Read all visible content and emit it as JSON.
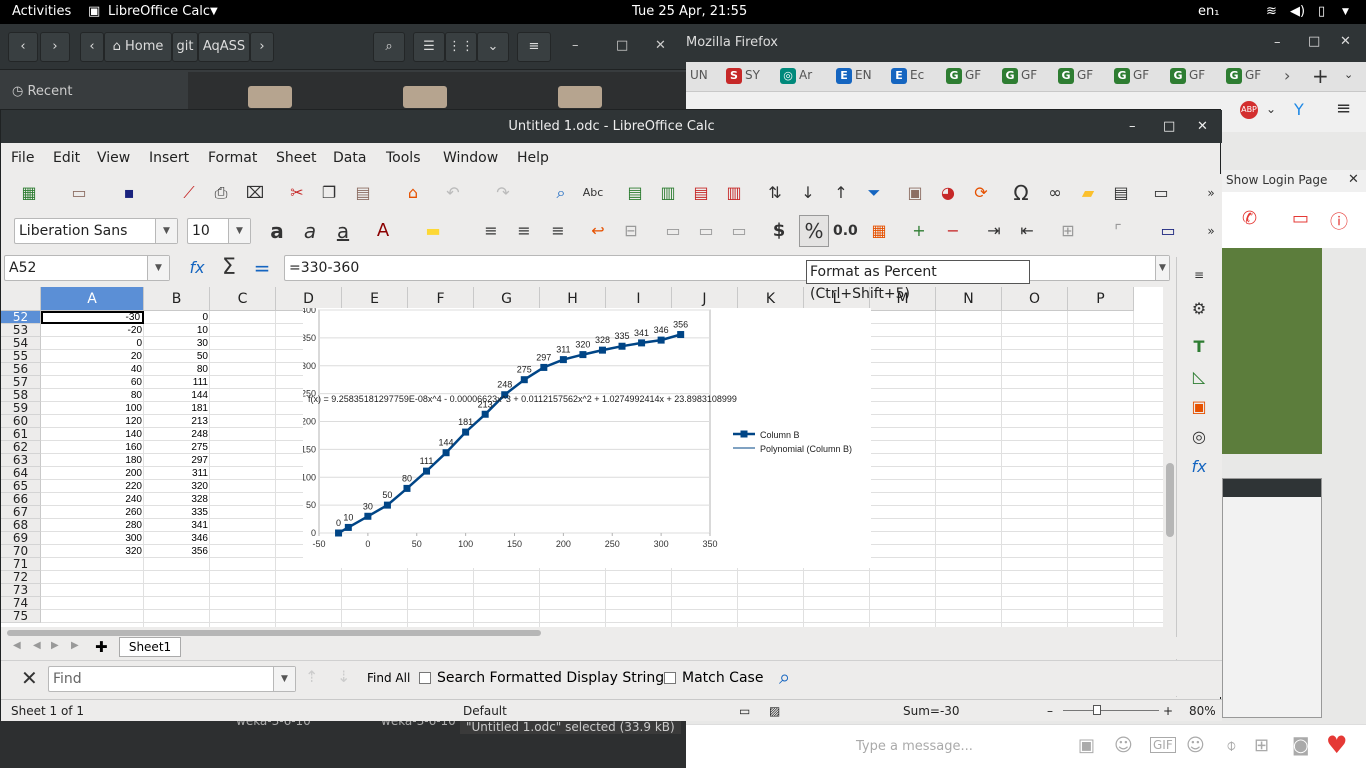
{
  "topbar": {
    "activities": "Activities",
    "app": "LibreOffice Calc",
    "clock": "Tue 25 Apr, 21:55",
    "lang": "en₁"
  },
  "files": {
    "home": "Home",
    "crumb2": "git",
    "crumb3": "AqASS",
    "recent": "Recent",
    "bottom1": "weka-3-6-10",
    "bottom2": "weka-3-6-10",
    "status": "\"Untitled 1.odc\" selected  (33.9 kB)"
  },
  "firefox": {
    "title": "Mozilla Firefox",
    "tabs": [
      "UN",
      "SY",
      "Ar",
      "EN",
      "Ec",
      "GF",
      "GF",
      "GF",
      "GF",
      "GF",
      "GF"
    ],
    "login": "Show Login Page",
    "message": "Type a message..."
  },
  "calc": {
    "title": "Untitled 1.odc - LibreOffice Calc",
    "menu": [
      "File",
      "Edit",
      "View",
      "Insert",
      "Format",
      "Sheet",
      "Data",
      "Tools",
      "Window",
      "Help"
    ],
    "font": "Liberation Sans",
    "size": "10",
    "namebox": "A52",
    "formula": "=330-360",
    "tooltip": "Format as Percent (Ctrl+Shift+5)",
    "pct": "%",
    "numfmt": "0.0",
    "dollar": "$",
    "columns": [
      "A",
      "B",
      "C",
      "D",
      "E",
      "F",
      "G",
      "H",
      "I",
      "J",
      "K",
      "L",
      "M",
      "N",
      "O",
      "P"
    ],
    "rows": [
      "52",
      "53",
      "54",
      "55",
      "56",
      "57",
      "58",
      "59",
      "60",
      "61",
      "62",
      "63",
      "64",
      "65",
      "66",
      "67",
      "68",
      "69",
      "70",
      "71",
      "72",
      "73",
      "74",
      "75"
    ],
    "colA": [
      "-30",
      "-20",
      "0",
      "20",
      "40",
      "60",
      "80",
      "100",
      "120",
      "140",
      "160",
      "180",
      "200",
      "220",
      "240",
      "260",
      "280",
      "300",
      "320"
    ],
    "colB": [
      "0",
      "10",
      "30",
      "50",
      "80",
      "111",
      "144",
      "181",
      "213",
      "248",
      "275",
      "297",
      "311",
      "320",
      "328",
      "335",
      "341",
      "346",
      "356"
    ],
    "sheet_tab": "Sheet1",
    "find_placeholder": "Find",
    "find_all": "Find All",
    "search_formatted": "Search Formatted Display String",
    "match_case": "Match Case",
    "status_sheet": "Sheet 1 of 1",
    "status_style": "Default",
    "status_sum": "Sum=-30",
    "zoom": "80%"
  },
  "chart_data": {
    "type": "scatter",
    "x": [
      -30,
      -20,
      0,
      20,
      40,
      60,
      80,
      100,
      120,
      140,
      160,
      180,
      200,
      220,
      240,
      260,
      280,
      300,
      320
    ],
    "series": [
      {
        "name": "Column B",
        "values": [
          0,
          10,
          30,
          50,
          80,
          111,
          144,
          181,
          213,
          248,
          275,
          297,
          311,
          320,
          328,
          335,
          341,
          346,
          356
        ]
      }
    ],
    "legend": [
      "Column B",
      "Polynomial (Column B)"
    ],
    "equation": "f(x) = 9.25835181297759E-08x^4 - 0.00006623x^3 + 0.0112157562x^2 + 1.0274992414x + 23.8983108999",
    "xticks": [
      "-50",
      "0",
      "50",
      "100",
      "150",
      "200",
      "250",
      "300",
      "350"
    ],
    "yticks": [
      "0",
      "50",
      "100",
      "150",
      "200",
      "250",
      "300",
      "350",
      "400"
    ],
    "xlim": [
      -50,
      350
    ],
    "ylim": [
      0,
      400
    ],
    "legend_position": "right",
    "color": "#004586"
  }
}
